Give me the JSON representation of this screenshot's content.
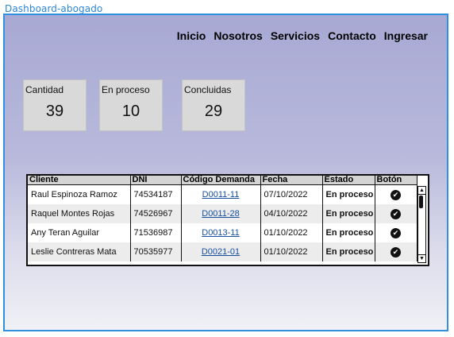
{
  "frame": {
    "title": "Dashboard-abogado"
  },
  "nav": {
    "items": [
      "Inicio",
      "Nosotros",
      "Servicios",
      "Contacto",
      "Ingresar"
    ]
  },
  "cards": [
    {
      "label": "Cantidad",
      "value": "39"
    },
    {
      "label": "En proceso",
      "value": "10"
    },
    {
      "label": "Concluidas",
      "value": "29"
    }
  ],
  "table": {
    "headers": [
      "Cliente",
      "DNI",
      "Código Demanda",
      "Fecha",
      "Estado",
      "Botón"
    ],
    "rows": [
      {
        "cliente": "Raul Espinoza Ramoz",
        "dni": "74534187",
        "codigo": "D0011-11",
        "fecha": "07/10/2022",
        "estado": "En proceso",
        "boton": "✔"
      },
      {
        "cliente": "Raquel Montes Rojas",
        "dni": "74526967",
        "codigo": "D0011-28",
        "fecha": "04/10/2022",
        "estado": "En proceso",
        "boton": "✔"
      },
      {
        "cliente": "Any Teran Aguilar",
        "dni": "71536987",
        "codigo": "D0013-11",
        "fecha": "01/10/2022",
        "estado": "En proceso",
        "boton": "✔"
      },
      {
        "cliente": "Leslie Contreras Mata",
        "dni": "70535977",
        "codigo": "D0021-01",
        "fecha": "01/10/2022",
        "estado": "En proceso",
        "boton": "✔"
      }
    ]
  },
  "scrollbar": {
    "up_icon": "▲",
    "down_icon": "▼"
  }
}
